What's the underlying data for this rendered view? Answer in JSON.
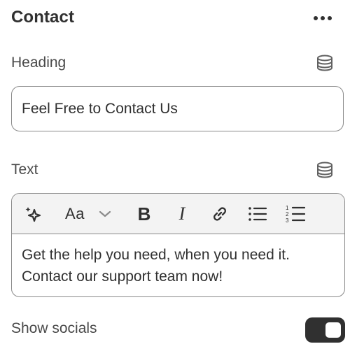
{
  "panel": {
    "title": "Contact",
    "more_icon": "ellipsis-horizontal-icon"
  },
  "heading": {
    "label": "Heading",
    "dynamic_source_icon": "database-icon",
    "value": "Feel Free to Contact Us"
  },
  "text": {
    "label": "Text",
    "dynamic_source_icon": "database-icon",
    "toolbar": {
      "ai_icon": "sparkle-icon",
      "format_label": "Aa",
      "format_dropdown_icon": "chevron-down-icon",
      "bold_label": "B",
      "italic_label": "I",
      "link_icon": "link-icon",
      "bullet_list_icon": "bulleted-list-icon",
      "numbered_list_icon": "numbered-list-icon"
    },
    "lines": [
      "Get the help you need, when you need it.",
      "Contact our support team now!"
    ]
  },
  "show_socials": {
    "label": "Show socials",
    "enabled": true
  },
  "colors": {
    "text": "#303030",
    "border": "#8a8a8a",
    "toggle_on": "#303030",
    "toolbar_bg": "#f3f3f3"
  }
}
